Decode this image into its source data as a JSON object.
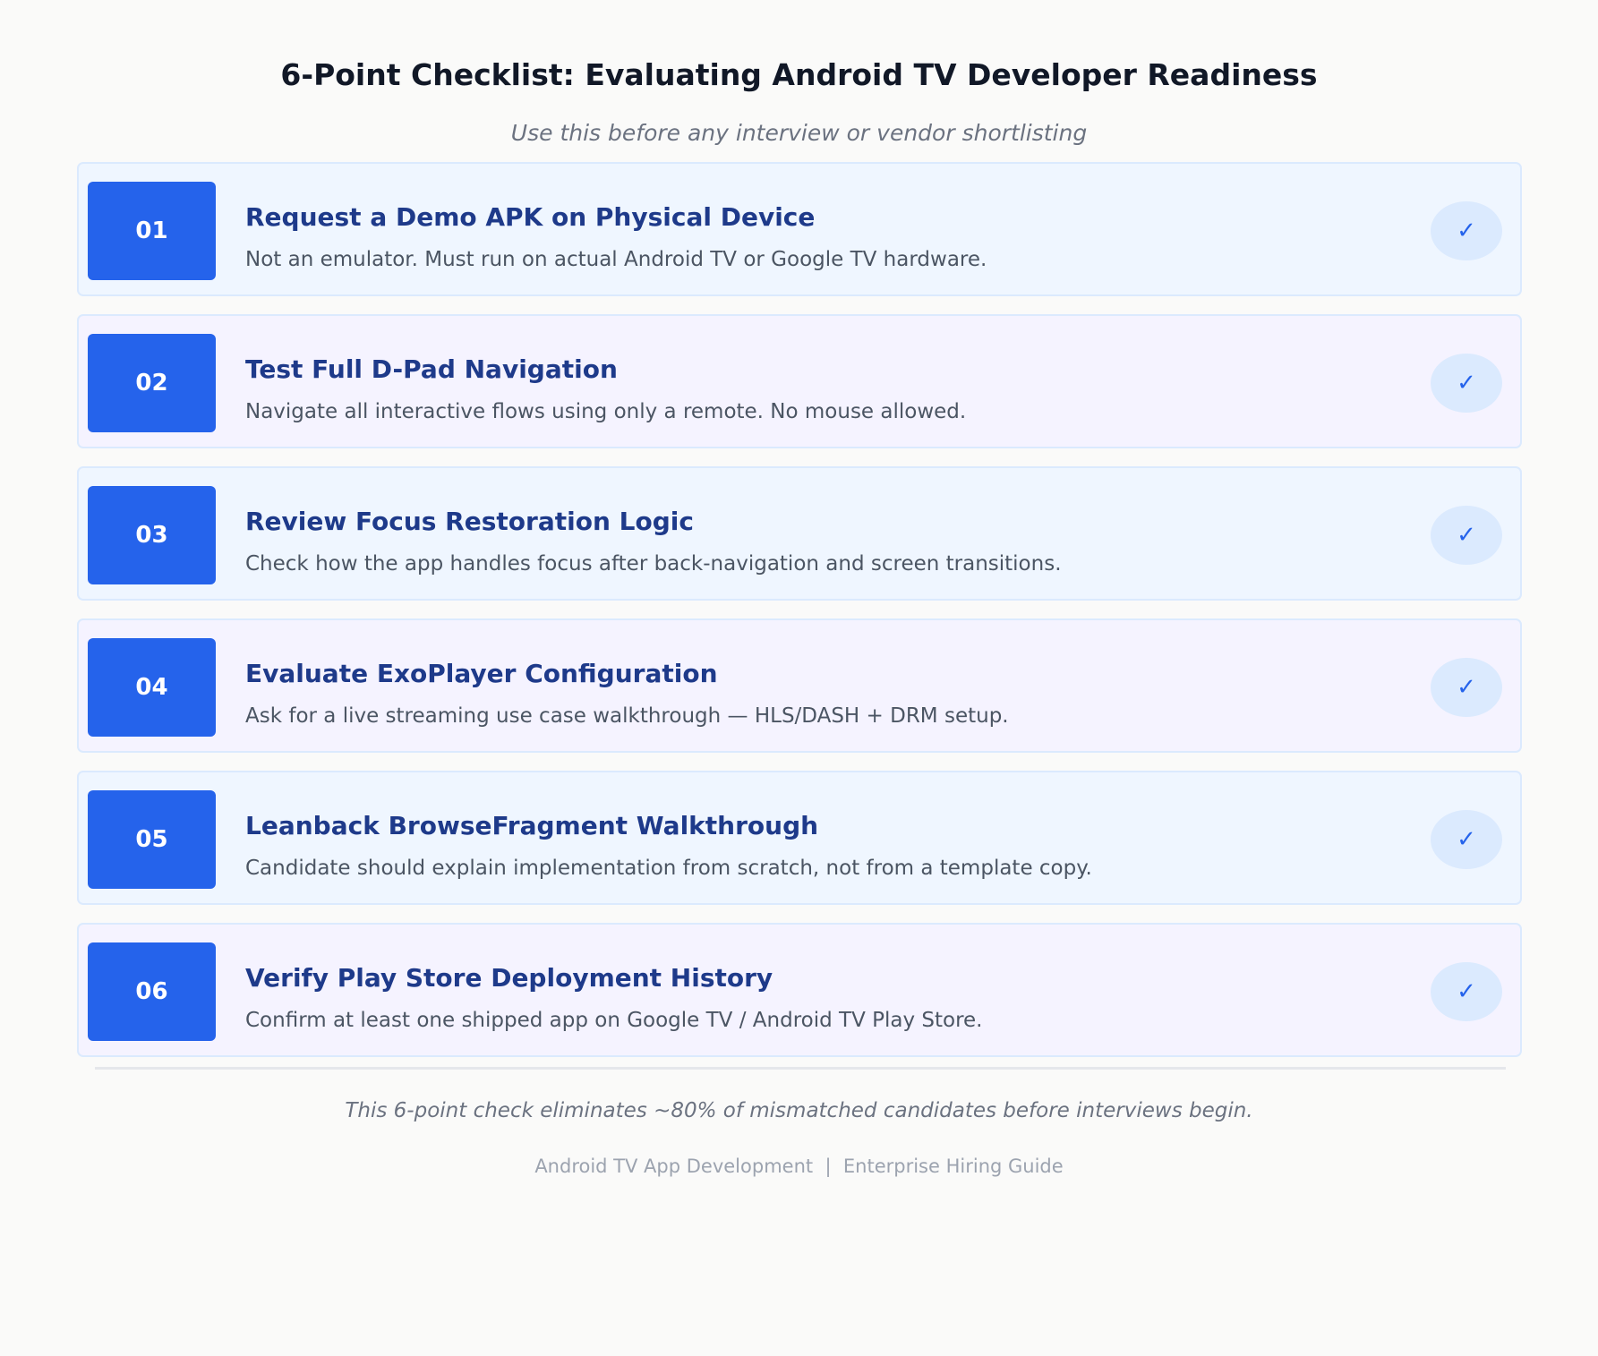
{
  "header": {
    "title": "6-Point Checklist: Evaluating Android TV Developer Readiness",
    "subtitle": "Use this before any interview or vendor shortlisting"
  },
  "items": [
    {
      "number": "01",
      "title": "Request a Demo APK on Physical Device",
      "description": "Not an emulator. Must run on actual Android TV or Google TV hardware.",
      "check": "✓"
    },
    {
      "number": "02",
      "title": "Test Full D-Pad Navigation",
      "description": "Navigate all interactive flows using only a remote. No mouse allowed.",
      "check": "✓"
    },
    {
      "number": "03",
      "title": "Review Focus Restoration Logic",
      "description": "Check how the app handles focus after back-navigation and screen transitions.",
      "check": "✓"
    },
    {
      "number": "04",
      "title": "Evaluate ExoPlayer Configuration",
      "description": "Ask for a live streaming use case walkthrough — HLS/DASH + DRM setup.",
      "check": "✓"
    },
    {
      "number": "05",
      "title": "Leanback BrowseFragment Walkthrough",
      "description": "Candidate should explain implementation from scratch, not from a template copy.",
      "check": "✓"
    },
    {
      "number": "06",
      "title": "Verify Play Store Deployment History",
      "description": "Confirm at least one shipped app on Google TV / Android TV Play Store.",
      "check": "✓"
    }
  ],
  "footer": {
    "summary": "This 6-point check eliminates ~80% of mismatched candidates before interviews begin.",
    "credit": "Android TV App Development  |  Enterprise Hiring Guide"
  },
  "colors": {
    "badge": "#2563eb",
    "title_text": "#1e3a8a",
    "card_blue": "#eff6ff",
    "card_lavender": "#f5f3ff",
    "check_bg": "#dbeafe"
  }
}
